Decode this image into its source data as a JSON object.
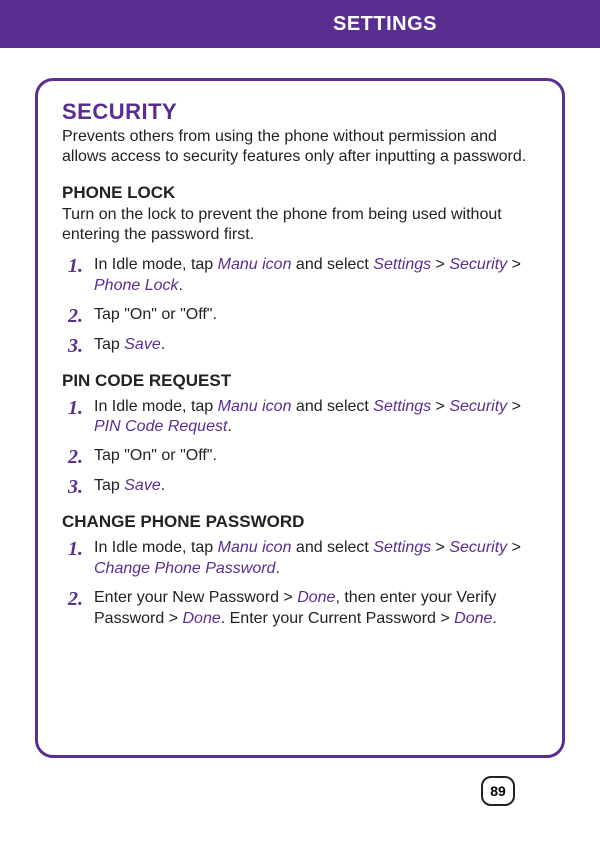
{
  "header": {
    "title": "SETTINGS"
  },
  "section": {
    "title": "SECURITY",
    "desc": "Prevents others from using the phone without permission and allows access to security features only after inputting a password."
  },
  "phone_lock": {
    "title": "PHONE LOCK",
    "desc": "Turn on the lock to prevent the phone from being used without entering the password first.",
    "step1_a": "In Idle mode, tap ",
    "step1_manu": "Manu icon",
    "step1_b": " and select ",
    "step1_settings": "Settings",
    "step1_gt1": " > ",
    "step1_security": "Security",
    "step1_gt2": " > ",
    "step1_phonelock": "Phone Lock",
    "step1_end": ".",
    "step2": "Tap \"On\" or \"Off\".",
    "step3_a": "Tap ",
    "step3_save": "Save",
    "step3_end": "."
  },
  "pin_code": {
    "title": "PIN CODE REQUEST",
    "step1_a": "In Idle mode, tap ",
    "step1_manu": "Manu icon",
    "step1_b": " and select ",
    "step1_settings": "Settings",
    "step1_gt1": " > ",
    "step1_security": "Security",
    "step1_gt2": " > ",
    "step1_pin": "PIN Code Request",
    "step1_end": ".",
    "step2": "Tap \"On\" or \"Off\".",
    "step3_a": "Tap ",
    "step3_save": "Save",
    "step3_end": "."
  },
  "change_pw": {
    "title": "CHANGE PHONE PASSWORD",
    "step1_a": "In Idle mode, tap ",
    "step1_manu": "Manu icon",
    "step1_b": " and select ",
    "step1_settings": "Settings",
    "step1_gt1": " > ",
    "step1_security": "Security",
    "step1_gt2": " > ",
    "step1_cpw": "Change Phone Password",
    "step1_end": ".",
    "step2_a": "Enter your New Password > ",
    "step2_done1": "Done",
    "step2_b": ", then enter your Verify Password > ",
    "step2_done2": "Done",
    "step2_c": ". Enter your Current Password > ",
    "step2_done3": "Done",
    "step2_end": "."
  },
  "nums": {
    "n1": "1.",
    "n2": "2.",
    "n3": "3."
  },
  "page": {
    "number": "89"
  }
}
